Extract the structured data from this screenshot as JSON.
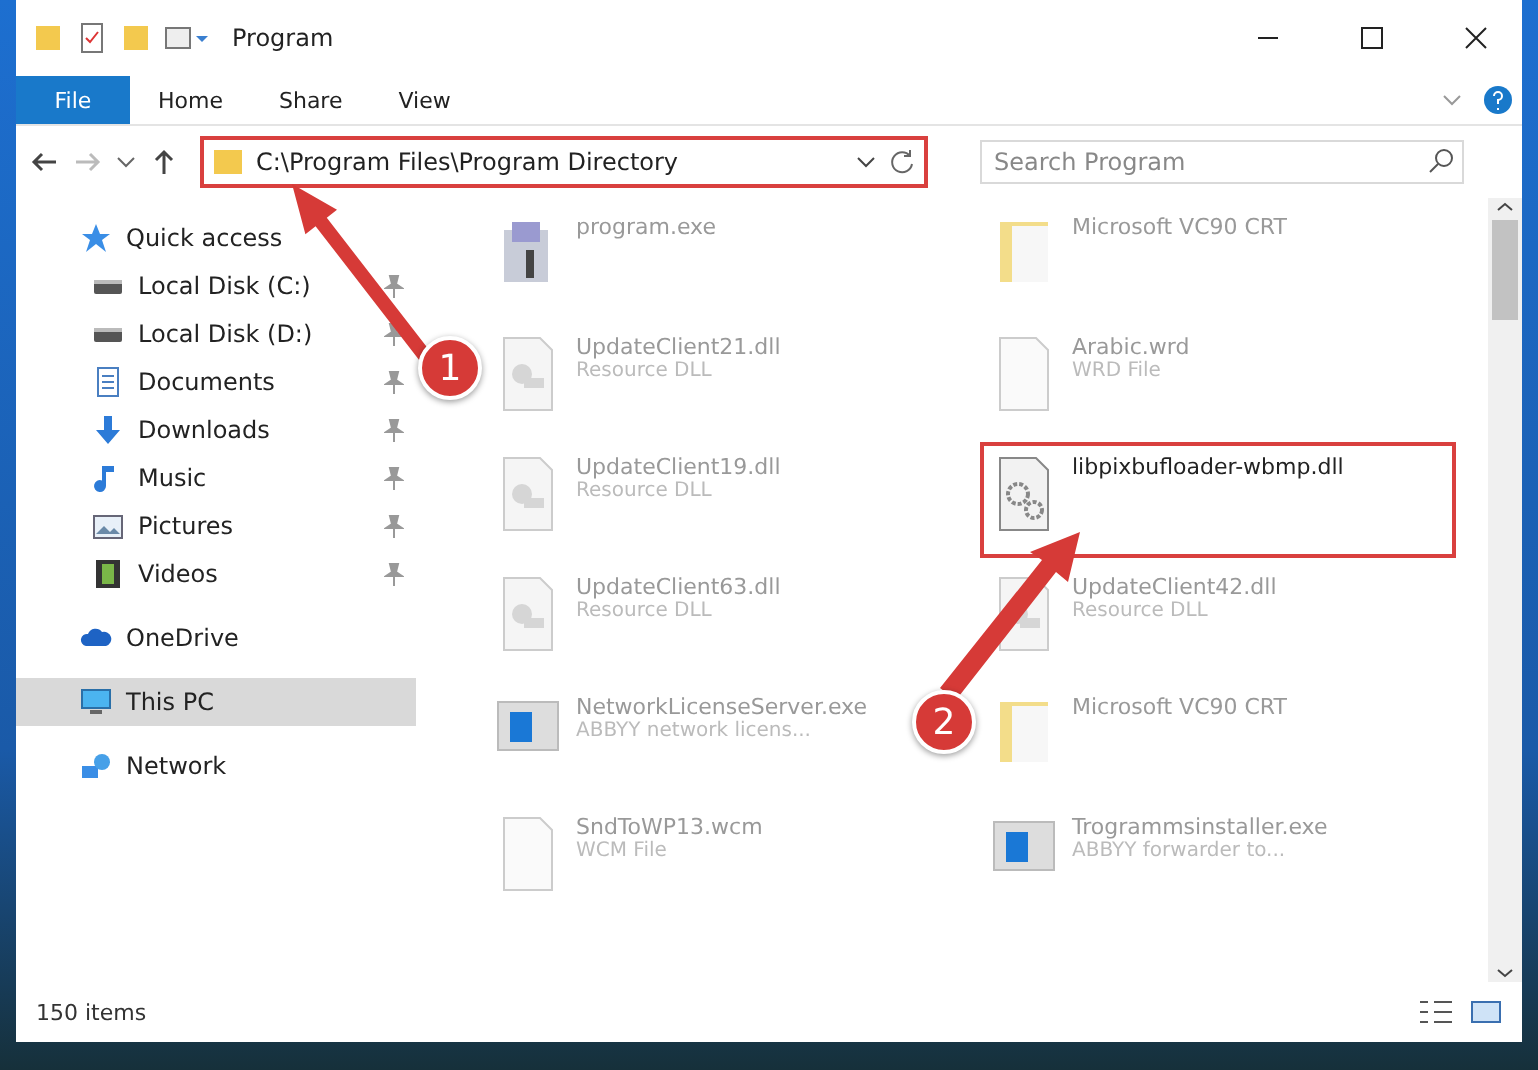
{
  "window": {
    "title": "Program"
  },
  "ribbon_tabs": [
    {
      "label": "File",
      "selected": true
    },
    {
      "label": "Home",
      "selected": false
    },
    {
      "label": "Share",
      "selected": false
    },
    {
      "label": "View",
      "selected": false
    }
  ],
  "address": {
    "path": "C:\\Program Files\\Program Directory",
    "highlighted": true
  },
  "search": {
    "placeholder": "Search Program"
  },
  "sidebar": {
    "items": [
      {
        "label": "Quick access",
        "kind": "star",
        "selected": false,
        "children": [
          {
            "label": "Local Disk (C:)",
            "kind": "disk",
            "pinned": true
          },
          {
            "label": "Local Disk (D:)",
            "kind": "disk",
            "pinned": true
          },
          {
            "label": "Documents",
            "kind": "document",
            "pinned": true
          },
          {
            "label": "Downloads",
            "kind": "download",
            "pinned": true
          },
          {
            "label": "Music",
            "kind": "music",
            "pinned": true
          },
          {
            "label": "Pictures",
            "kind": "picture",
            "pinned": true
          },
          {
            "label": "Videos",
            "kind": "video",
            "pinned": true
          }
        ]
      },
      {
        "label": "OneDrive",
        "kind": "cloud",
        "selected": false
      },
      {
        "label": "This PC",
        "kind": "computer",
        "selected": true
      },
      {
        "label": "Network",
        "kind": "network",
        "selected": false
      }
    ]
  },
  "files": [
    {
      "name": "program.exe",
      "kind": "exe",
      "highlighted": false
    },
    {
      "name": "Microsoft VC90 CRT",
      "kind": "folder",
      "highlighted": false
    },
    {
      "name": "UpdateClient21.dll",
      "type": "Resource DLL",
      "kind": "dll",
      "highlighted": false
    },
    {
      "name": "Arabic.wrd",
      "type": "WRD File",
      "kind": "file",
      "highlighted": false
    },
    {
      "name": "UpdateClient19.dll",
      "type": "Resource DLL",
      "kind": "dll",
      "highlighted": false
    },
    {
      "name": "libpixbufloader-wbmp.dll",
      "kind": "gears",
      "highlighted": true
    },
    {
      "name": "UpdateClient63.dll",
      "type": "Resource DLL",
      "kind": "dll",
      "highlighted": false
    },
    {
      "name": "UpdateClient42.dll",
      "type": "Resource DLL",
      "kind": "dll",
      "highlighted": false
    },
    {
      "name": "NetworkLicenseServer.exe",
      "type": "ABBYY network licens...",
      "kind": "app",
      "highlighted": false
    },
    {
      "name": "Microsoft VC90 CRT",
      "kind": "folder",
      "highlighted": false
    },
    {
      "name": "SndToWP13.wcm",
      "type": "WCM File",
      "kind": "file",
      "highlighted": false
    },
    {
      "name": "Trogrammsinstaller.exe",
      "type": "ABBYY forwarder to...",
      "kind": "app",
      "highlighted": false
    }
  ],
  "annotations": [
    {
      "number": "1"
    },
    {
      "number": "2"
    }
  ],
  "status_bar": {
    "count": "150 items"
  }
}
